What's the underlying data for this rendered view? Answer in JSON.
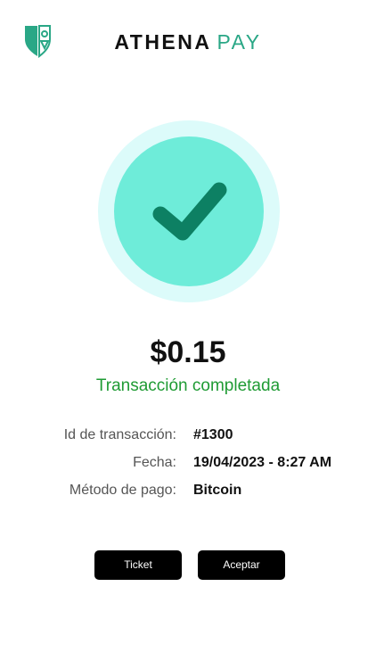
{
  "header": {
    "brand_name": "ATHENA",
    "brand_suffix": "PAY",
    "logo_icon": "shield-logo-icon",
    "logo_color": "#2aa786"
  },
  "status_graphic": {
    "icon": "checkmark-icon",
    "outer_color": "#dcfbfa",
    "inner_color": "#6eecd9",
    "check_color": "#0d8063"
  },
  "transaction": {
    "amount": "$0.15",
    "status_text": "Transacción completada",
    "status_color": "#1f9b34",
    "details": [
      {
        "label": "Id de transacción:",
        "value": "#1300"
      },
      {
        "label": "Fecha:",
        "value": "19/04/2023 - 8:27 AM"
      },
      {
        "label": "Método de pago:",
        "value": "Bitcoin"
      }
    ]
  },
  "actions": {
    "ticket_label": "Ticket",
    "accept_label": "Aceptar"
  }
}
